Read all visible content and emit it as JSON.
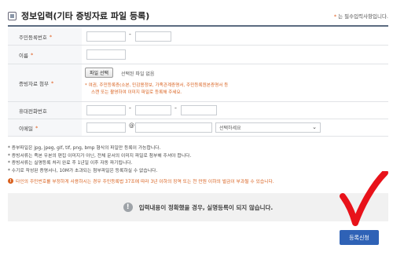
{
  "header": {
    "title": "정보입력(기타 증빙자료 파일 등록)",
    "required_note_star": "*",
    "required_note": "는 필수입력사항입니다."
  },
  "form": {
    "resident_number": {
      "label": "주민등록번호",
      "star": "*",
      "dash": "-"
    },
    "name": {
      "label": "이름",
      "star": "*"
    },
    "attachment": {
      "label": "증빙자료 첨부",
      "star": "*",
      "file_button": "파일 선택",
      "file_status": "선택된 파일 없음",
      "notice_line1": "* 여권, 주민등록증(소본, 민감용정보, 가족관계증명서, 주민등록원본증명서 등",
      "notice_line2": "스캔 또는 촬영하여 이미지 파일로 등록해 주세요."
    },
    "mobile": {
      "label": "휴대전화번호",
      "dash1": "-",
      "dash2": "-"
    },
    "email": {
      "label": "이메일",
      "star": "*",
      "at": "@",
      "select_value": "선택하세요",
      "chevron": "⌄"
    }
  },
  "notes": [
    "* 증부파일은 jpg, jpeg, gif, tif, png, bmp 형식의 파일만 등록이 가능합니다.",
    "* 증빙서류는 족본 우본의 편집 이미지가 아닌, 전체 문서의 이미지 파일로 첨부해 주셔야 합니다.",
    "* 증빙서류는 실명등록 처리 완료 후 1년일 이후 자동 파기됩니다.",
    "* 수기로 작성된 증명서나, 10M가 초과되는 첨부파일은 등록하실 수 없습니다."
  ],
  "warning": {
    "icon": "!",
    "text": "타인의 주민번호를 부정하게 사용하시는 경우 주민등록법 37조에 따라 3년 이하의 징역 또는 천 만원 이하의 벌금이 부과될 수 있습니다."
  },
  "info": {
    "icon": "!",
    "text": "입력내용이 정확했을 경우, 실명등록이 되지 않습니다."
  },
  "submit_button": "등록신청",
  "colors": {
    "accent_blue": "#2f62b6",
    "required_orange": "#e05a1a",
    "check_red": "#e8121a"
  }
}
